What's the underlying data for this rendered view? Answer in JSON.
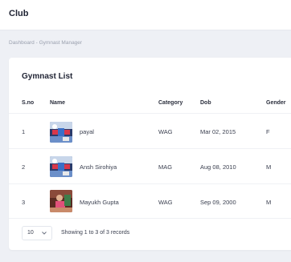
{
  "app": {
    "title": "Club"
  },
  "breadcrumb": {
    "root": "Dashboard",
    "separator": "-",
    "current": "Gymnast Manager"
  },
  "list": {
    "title": "Gymnast List",
    "columns": {
      "sno": "S.no",
      "name": "Name",
      "category": "Category",
      "dob": "Dob",
      "gender": "Gender"
    },
    "rows": [
      {
        "sno": "1",
        "name": "payal",
        "category": "WAG",
        "dob": "Mar 02, 2015",
        "gender": "F"
      },
      {
        "sno": "2",
        "name": "Ansh Sirohiya",
        "category": "MAG",
        "dob": "Aug 08, 2010",
        "gender": "M"
      },
      {
        "sno": "3",
        "name": "Mayukh Gupta",
        "category": "WAG",
        "dob": "Sep 09, 2000",
        "gender": "M"
      }
    ]
  },
  "pagination": {
    "page_size": "10",
    "summary": "Showing 1 to 3 of 3 records"
  },
  "icons": {
    "avatar": "gymnast-photo-icon",
    "dropdown": "chevron-down-icon"
  },
  "colors": {
    "background": "#eef0f5",
    "card": "#ffffff",
    "text": "#2f3445",
    "muted": "#9aa0ae"
  }
}
